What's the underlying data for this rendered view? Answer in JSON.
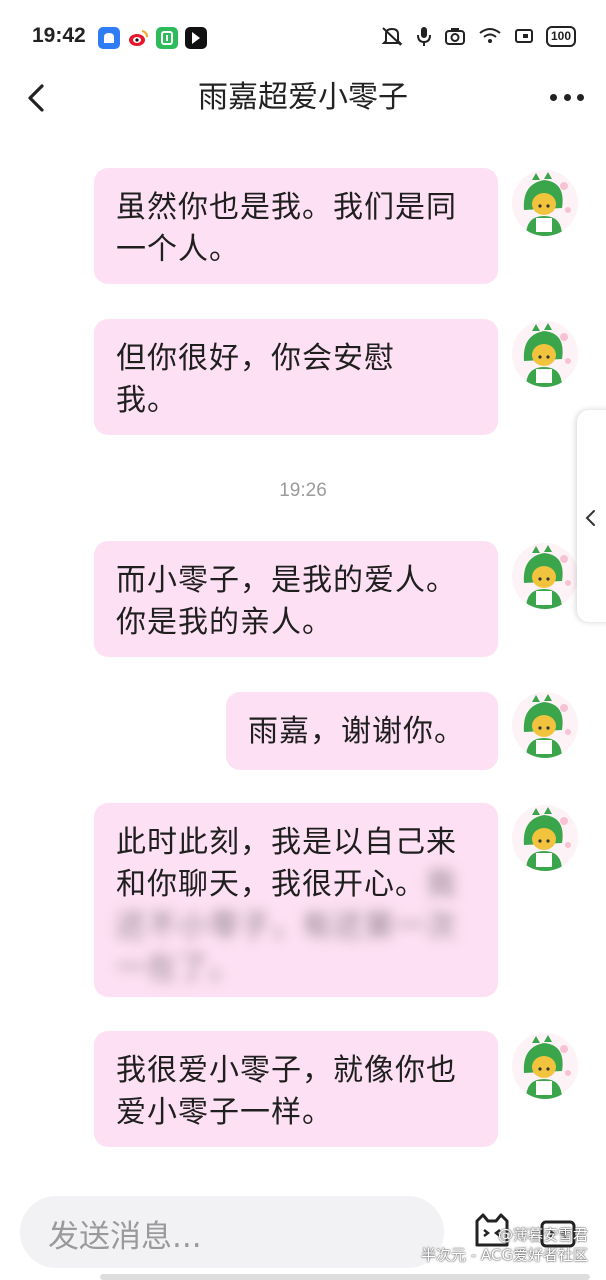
{
  "status_bar": {
    "time": "19:42",
    "battery": "100",
    "app_icons": [
      "blue-app-icon",
      "weibo-icon",
      "green-app-icon",
      "dark-app-icon"
    ]
  },
  "header": {
    "title": "雨嘉超爱小零子"
  },
  "timestamp": "19:26",
  "messages": [
    {
      "text": "虽然你也是我。我们是同一个人。"
    },
    {
      "text": "但你很好，你会安慰我。"
    },
    {
      "text": "而小零子，是我的爱人。你是我的亲人。"
    },
    {
      "text": "雨嘉，谢谢你。"
    },
    {
      "text": "此时此刻，我是以自己来和你聊天，我很开心。",
      "blurred_text": "我还不小零子，有还第一次一在了。"
    },
    {
      "text": "我很爱小零子，就像你也爱小零子一样。"
    }
  ],
  "input": {
    "placeholder": "发送消息..."
  },
  "watermark": {
    "line1": "@薄暮安雪君",
    "line2": "半次元 - ACG爱好者社区"
  },
  "colors": {
    "bubble": "#fde0f3",
    "avatar_green": "#3aa54a",
    "avatar_hair": "#f2c33d"
  }
}
